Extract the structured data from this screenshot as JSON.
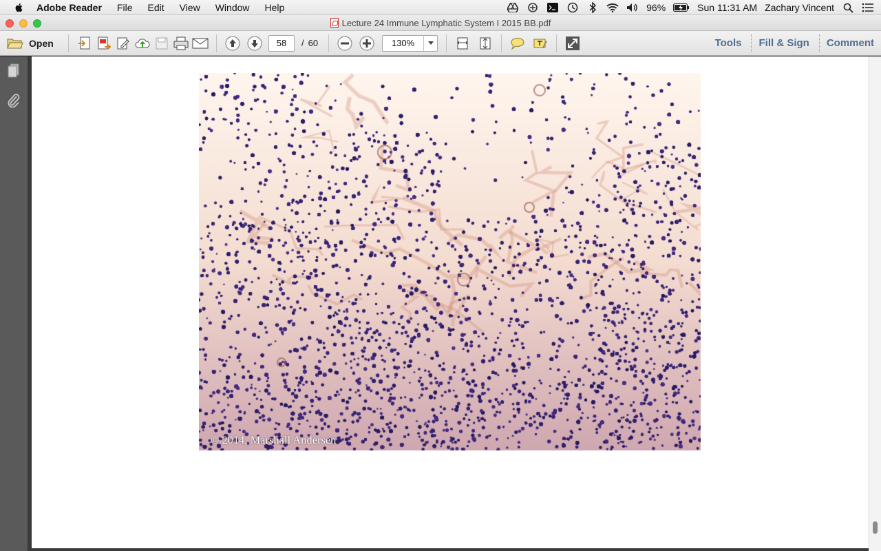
{
  "menubar": {
    "app_name": "Adobe Reader",
    "items": [
      "File",
      "Edit",
      "View",
      "Window",
      "Help"
    ],
    "battery": "96%",
    "clock": "Sun 11:31 AM",
    "user": "Zachary Vincent"
  },
  "window": {
    "title": "Lecture 24 Immune Lymphatic System I 2015 BB.pdf"
  },
  "toolbar": {
    "open_label": "Open",
    "page_current": "58",
    "page_separator": "/",
    "page_total": "60",
    "zoom": "130%",
    "tools_label": "Tools",
    "fill_sign_label": "Fill & Sign",
    "comment_label": "Comment"
  },
  "document": {
    "image_caption": "© 2014, Marshall Andersen",
    "scroll_position": 0.97
  },
  "colors": {
    "link_blue": "#4f6d91",
    "nav_bg": "#5a5a5a",
    "stain_purple": "#2d1e6b",
    "stain_pink": "#d9a48f"
  }
}
